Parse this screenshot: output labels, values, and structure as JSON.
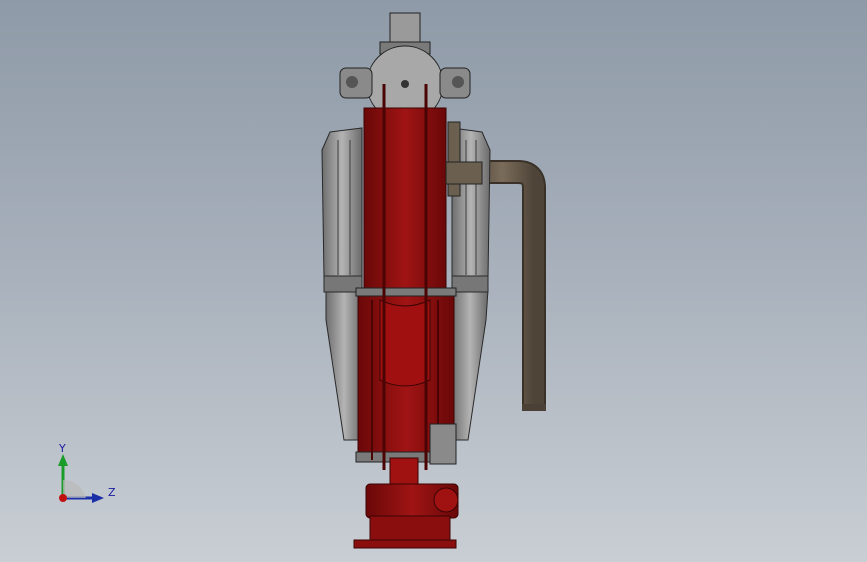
{
  "viewport": {
    "background_top": "#8f9aa8",
    "background_bottom": "#c9ced4"
  },
  "model": {
    "primary_color": "#8b0e0e",
    "dark_red": "#5a0606",
    "gray_body": "#8c8c8c",
    "pipe_color": "#6b5e4e"
  },
  "triad": {
    "y_label": "Y",
    "z_label": "Z",
    "y_color": "#1a9b2a",
    "z_color": "#1a2ea8",
    "x_color": "#c01010"
  }
}
